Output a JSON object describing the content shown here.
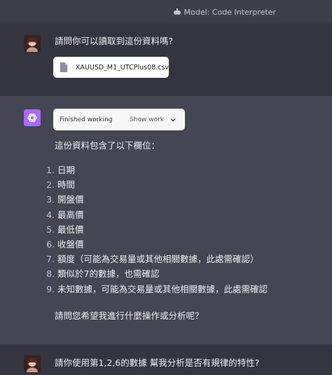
{
  "header": {
    "model_label": "Model: Code Interpreter"
  },
  "conversation": {
    "user_message_1": "請問你可以讀取到這份資料嗎?",
    "attachment_name": "XAUUSD_M1_UTCPlus08.csv",
    "tool_status": "Finished working",
    "show_work_label": "Show work",
    "assistant_intro": "這份資料包含了以下欄位：",
    "fields": [
      {
        "num": "1.",
        "text": "日期"
      },
      {
        "num": "2.",
        "text": "時間"
      },
      {
        "num": "3.",
        "text": "開盤價"
      },
      {
        "num": "4.",
        "text": "最高價"
      },
      {
        "num": "5.",
        "text": "最低價"
      },
      {
        "num": "6.",
        "text": "收盤價"
      },
      {
        "num": "7.",
        "text": "額度（可能為交易量或其他相關數據，此處需確認）"
      },
      {
        "num": "8.",
        "text": "類似於7的數據，也需確認"
      },
      {
        "num": "9.",
        "text": "未知數據，可能為交易量或其他相關數據，此處需確認"
      }
    ],
    "assistant_question": "請問您希望我進行什麼操作或分析呢？",
    "user_message_2": "請你使用第1,2,6的數據 幫我分析是否有規律的特性?"
  },
  "colors": {
    "user_bg": "#343541",
    "assistant_bg": "#444654",
    "assistant_avatar": "#ab68ff"
  }
}
